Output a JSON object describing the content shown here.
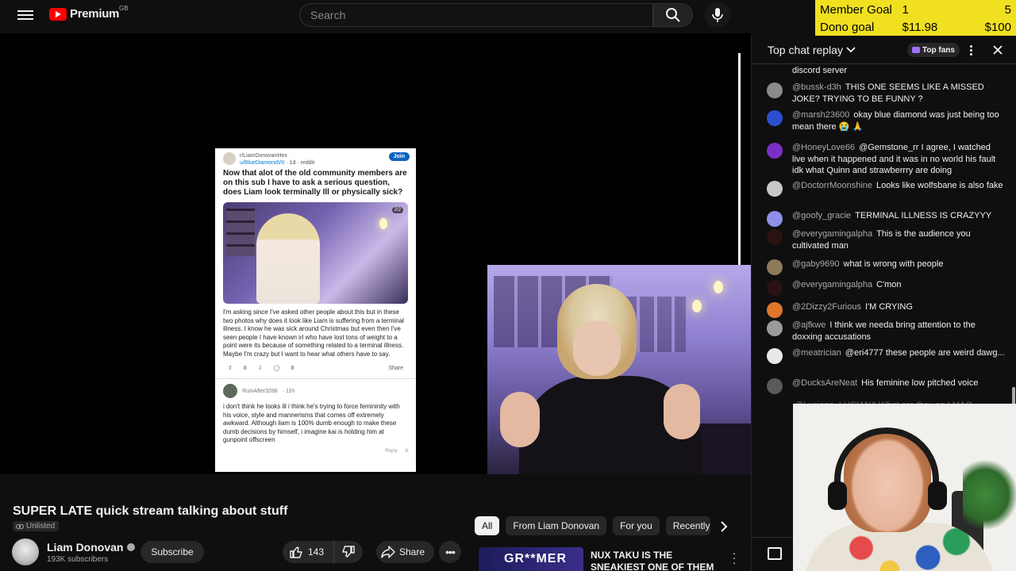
{
  "topbar": {
    "logo_text": "Premium",
    "logo_region": "GB",
    "search_placeholder": "Search"
  },
  "goals": [
    {
      "label": "Member Goal",
      "current": "1",
      "target": "5"
    },
    {
      "label": "Dono goal",
      "current": "$11.98",
      "target": "$100"
    }
  ],
  "video_content": {
    "reddit_post": {
      "subreddit": "r/LiamDonovanHex",
      "user": "u/BlueDiamondVII",
      "meta": "· 1d · reddit",
      "join_label": "Join",
      "title": "Now that alot of the old community members are on this sub I have to ask a serious question, does Liam look terminally Ill or physically sick?",
      "image_badge": "2/2",
      "body": "I'm asking since I've asked other people about this but in these two photos why does it look like Liam is suffering from a terminal illness. I know he was sick around Christmas but even then I've seen people I have known irl who have lost tons of weight to a point were its because of something related to a terminal illness. Maybe I'm crazy but I want to hear what others have to say.",
      "upvotes": "8",
      "comments": "8",
      "share_label": "Share",
      "comment_author": "RuinAfter3288",
      "comment_meta": "· 11h",
      "comment_text": "i don't think he looks ill i think he's trying to force femininity with his voice, style and mannerisms that comes off extremely awkward. Although liam is 100% dumb enough to make these dumb decisions by himself, i imagine kai is holding him at gunpoint offscreen",
      "comment_reply": "Reply",
      "comment_votes": "8"
    }
  },
  "video": {
    "title": "SUPER LATE quick stream talking about stuff",
    "visibility": "Unlisted",
    "channel_name": "Liam Donovan",
    "subscribers": "193K subscribers",
    "subscribe_label": "Subscribe",
    "likes": "143",
    "share_label": "Share"
  },
  "chips": [
    "All",
    "From Liam Donovan",
    "For you",
    "Recently"
  ],
  "recommendation": {
    "thumb_text": "GR**MER",
    "title": "NUX TAKU IS THE SNEAKIEST ONE OF THEM ALL"
  },
  "chat": {
    "header_title": "Top chat replay",
    "top_fans_label": "Top fans",
    "partial_top": "discord server",
    "messages": [
      {
        "author": "@bussk-d3h",
        "text": "THIS ONE SEEMS LIKE A MISSED JOKE? TRYING TO BE FUNNY ?",
        "color": "#8a8a8a"
      },
      {
        "author": "@marsh23600",
        "text": "okay blue diamond was just being too mean there 😭 🙏",
        "color": "#2a4fd0"
      },
      {
        "author": "@HoneyLove66",
        "text": "@Gemstone_rr I agree, I watched live when it happened and it was in no world his fault idk what Quinn and strawberrry are doing",
        "color": "#7b2fc8"
      },
      {
        "author": "@DoctorrMoonshine",
        "text": "Looks like wolfsbane is also fake",
        "color": "#c8c8c8"
      },
      {
        "author": "@goofy_gracie",
        "text": "TERMINAL ILLNESS IS CRAZYYY",
        "color": "#8f8fe8"
      },
      {
        "author": "@everygamingalpha",
        "text": "This is the audience you cultivated man",
        "color": "#2a1212"
      },
      {
        "author": "@gaby9690",
        "text": "what is wrong with people",
        "color": "#8c7a5a"
      },
      {
        "author": "@everygamingalpha",
        "text": "C'mon",
        "color": "#2a1212"
      },
      {
        "author": "@2Dizzy2Furious",
        "text": "I'M CRYING",
        "color": "#e0762a"
      },
      {
        "author": "@ajfkwe",
        "text": "I think we needa bring attention to the doxxing accusations",
        "color": "#9a9a9a"
      },
      {
        "author": "@meatrician",
        "text": "@eri4777 these people are weird dawg...",
        "color": "#e8e8e8"
      },
      {
        "author": "@DucksAreNeat",
        "text": "His feminine low pitched voice",
        "color": "#5a5a5a"
      }
    ],
    "partial_bottom": "@Luciana_LUCIANA What are they on LMAO"
  }
}
